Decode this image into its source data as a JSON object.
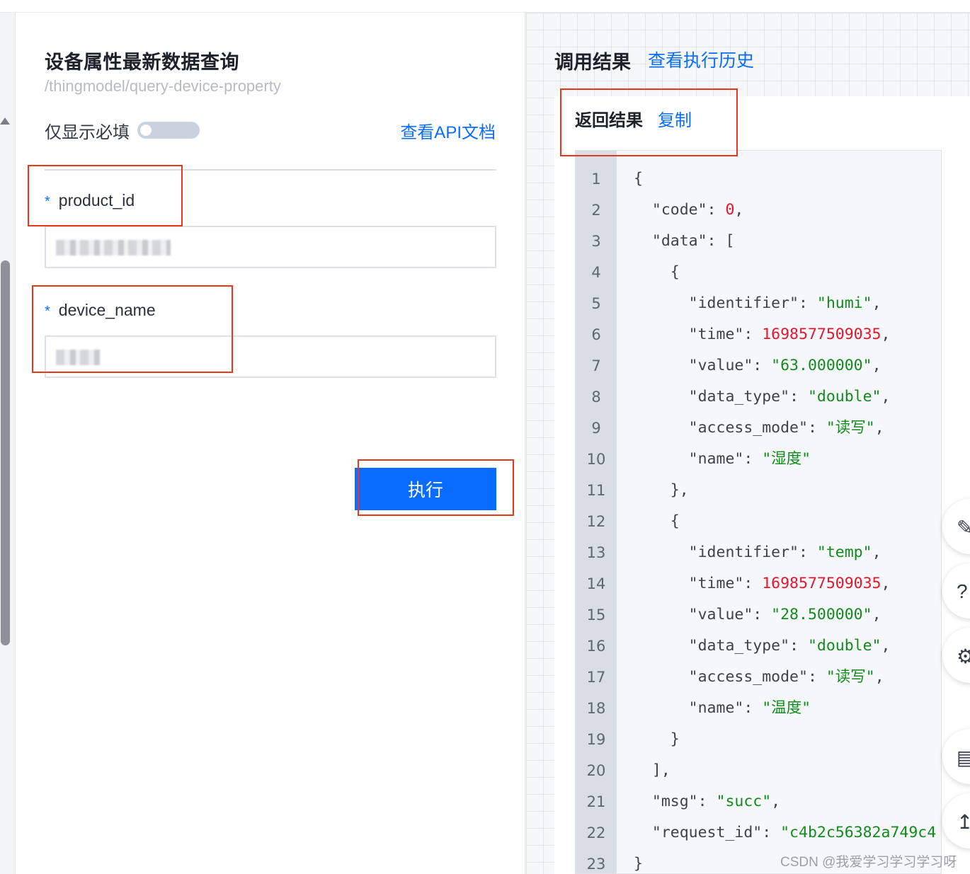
{
  "form": {
    "title": "设备属性最新数据查询",
    "path": "/thingmodel/query-device-property",
    "required_only_label": "仅显示必填",
    "api_doc_link": "查看API文档",
    "fields": [
      {
        "required_mark": "*",
        "label": "product_id",
        "value_masked": true
      },
      {
        "required_mark": "*",
        "label": "device_name",
        "value_masked": true
      }
    ],
    "execute_label": "执行"
  },
  "result": {
    "title": "调用结果",
    "history_link": "查看执行历史",
    "return_label": "返回结果",
    "copy_label": "复制",
    "lines": [
      {
        "n": "1",
        "text": "{"
      },
      {
        "n": "2",
        "text": "  \"code\": 0,"
      },
      {
        "n": "3",
        "text": "  \"data\": ["
      },
      {
        "n": "4",
        "text": "    {"
      },
      {
        "n": "5",
        "text": "      \"identifier\": \"humi\","
      },
      {
        "n": "6",
        "text": "      \"time\": 1698577509035,"
      },
      {
        "n": "7",
        "text": "      \"value\": \"63.000000\","
      },
      {
        "n": "8",
        "text": "      \"data_type\": \"double\","
      },
      {
        "n": "9",
        "text": "      \"access_mode\": \"读写\","
      },
      {
        "n": "10",
        "text": "      \"name\": \"湿度\""
      },
      {
        "n": "11",
        "text": "    },"
      },
      {
        "n": "12",
        "text": "    {"
      },
      {
        "n": "13",
        "text": "      \"identifier\": \"temp\","
      },
      {
        "n": "14",
        "text": "      \"time\": 1698577509035,"
      },
      {
        "n": "15",
        "text": "      \"value\": \"28.500000\","
      },
      {
        "n": "16",
        "text": "      \"data_type\": \"double\","
      },
      {
        "n": "17",
        "text": "      \"access_mode\": \"读写\","
      },
      {
        "n": "18",
        "text": "      \"name\": \"温度\""
      },
      {
        "n": "19",
        "text": "    }"
      },
      {
        "n": "20",
        "text": "  ],"
      },
      {
        "n": "21",
        "text": "  \"msg\": \"succ\","
      },
      {
        "n": "22",
        "text": "  \"request_id\": \"c4b2c56382a749c4"
      },
      {
        "n": "23",
        "text": "}"
      }
    ]
  },
  "side_tools": [
    "edit-icon",
    "help-icon",
    "settings-icon",
    "form-icon",
    "collapse-icon"
  ],
  "watermark": "CSDN @我爱学习学习学习呀",
  "colors": {
    "accent": "#0a6cff",
    "annotation": "#e8361c",
    "number": "#e8142b",
    "string": "#128a1c"
  }
}
